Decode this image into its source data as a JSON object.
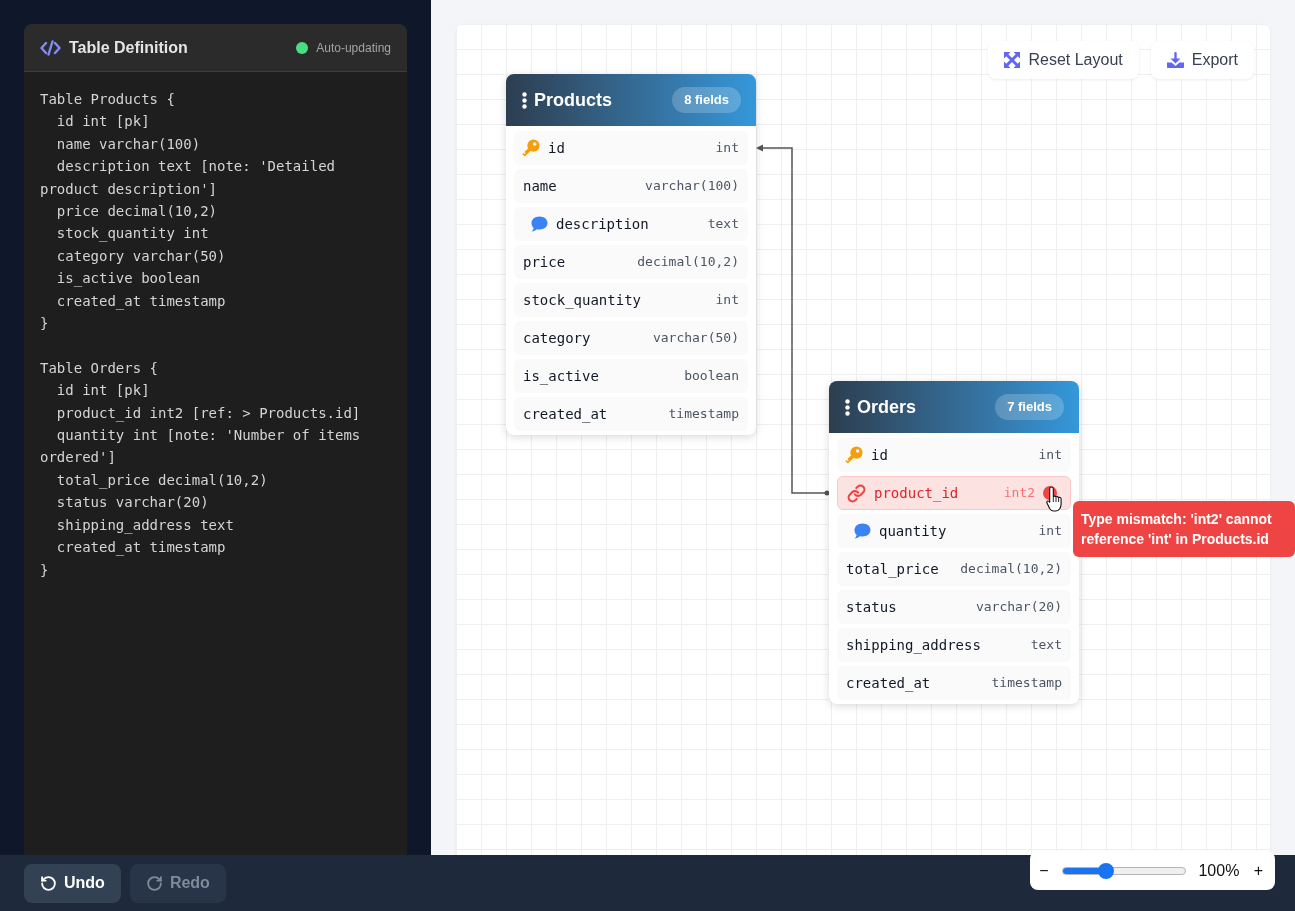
{
  "editor": {
    "title": "Table Definition",
    "status": "Auto-updating",
    "code_blocks": [
      {
        "lines": [
          "Table Products {",
          "  id int [pk]",
          "  name varchar(100)",
          "  description text [note: 'Detailed product description']",
          "  price decimal(10,2)",
          "  stock_quantity int",
          "  category varchar(50)",
          "  is_active boolean",
          "  created_at timestamp",
          "}"
        ]
      },
      {
        "lines": [
          "Table Orders {",
          "  id int [pk]",
          "  product_id int2 [ref: > Products.id]",
          "  quantity int [note: 'Number of items ordered']",
          "  total_price decimal(10,2)",
          "  status varchar(20)",
          "  shipping_address text",
          "  created_at timestamp",
          "}"
        ]
      }
    ]
  },
  "canvas": {
    "toolbar": [
      {
        "label": "Reset Layout",
        "kind": "reset"
      },
      {
        "label": "Export",
        "kind": "export"
      }
    ],
    "tables": [
      {
        "name": "Products",
        "badge": "8 fields",
        "fields": [
          {
            "name": "id",
            "type": "int",
            "kind": "pk",
            "error": false
          },
          {
            "name": "name",
            "type": "varchar(100)",
            "kind": "plain",
            "error": false
          },
          {
            "name": "description",
            "type": "text",
            "kind": "note",
            "error": false
          },
          {
            "name": "price",
            "type": "decimal(10,2)",
            "kind": "plain",
            "error": false
          },
          {
            "name": "stock_quantity",
            "type": "int",
            "kind": "plain",
            "error": false
          },
          {
            "name": "category",
            "type": "varchar(50)",
            "kind": "plain",
            "error": false
          },
          {
            "name": "is_active",
            "type": "boolean",
            "kind": "plain",
            "error": false
          },
          {
            "name": "created_at",
            "type": "timestamp",
            "kind": "plain",
            "error": false
          }
        ]
      },
      {
        "name": "Orders",
        "badge": "7 fields",
        "fields": [
          {
            "name": "id",
            "type": "int",
            "kind": "pk",
            "error": false
          },
          {
            "name": "product_id",
            "type": "int2",
            "kind": "ref",
            "error": true,
            "tooltip": "Type mismatch: 'int2' cannot reference 'int' in Products.id"
          },
          {
            "name": "quantity",
            "type": "int",
            "kind": "note",
            "error": false
          },
          {
            "name": "total_price",
            "type": "decimal(10,2)",
            "kind": "plain",
            "error": false
          },
          {
            "name": "status",
            "type": "varchar(20)",
            "kind": "plain",
            "error": false
          },
          {
            "name": "shipping_address",
            "type": "text",
            "kind": "plain",
            "error": false
          },
          {
            "name": "created_at",
            "type": "timestamp",
            "kind": "plain",
            "error": false
          }
        ]
      }
    ]
  },
  "history": [
    {
      "label": "Undo",
      "kind": "undo",
      "disabled": false
    },
    {
      "label": "Redo",
      "kind": "redo",
      "disabled": true
    }
  ],
  "zoom": {
    "minus": "−",
    "level": 0.35,
    "reading": "100%",
    "plus": "+"
  }
}
